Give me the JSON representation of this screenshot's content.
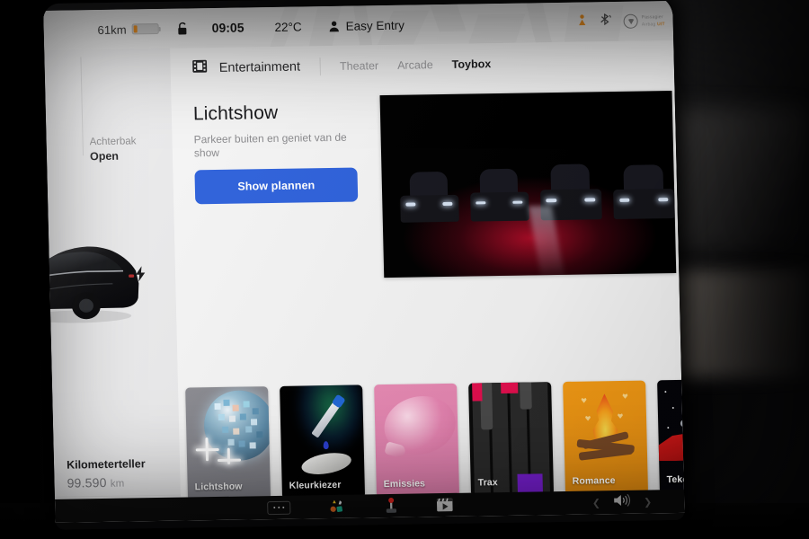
{
  "statusbar": {
    "range": "61km",
    "battery_fill_color": "#e8830c",
    "lock_icon": "lock-icon",
    "clock": "09:05",
    "temperature": "22°C",
    "driver_profile_icon": "person-icon",
    "driver_profile": "Easy Entry",
    "right_icons": [
      {
        "name": "seat-heater-icon",
        "color": "#e0891f"
      },
      {
        "name": "bluetooth-icon",
        "color": "#4c4c4c"
      }
    ],
    "account_chip": {
      "logo_icon": "tesla-logo-icon",
      "line1": "Passagier",
      "line2": "Airbag",
      "line2_status": "UIT"
    }
  },
  "sidebar": {
    "trunk": {
      "label": "Achterbak",
      "state": "Open"
    },
    "car_image": "tesla-model-3-rear-render",
    "charge_port_icon": "lightning-bolt-icon",
    "odometer": {
      "label": "Kilometerteller",
      "value": "99.590",
      "unit": "km"
    }
  },
  "app": {
    "icon": "entertainment-film-icon",
    "name": "Entertainment",
    "tabs": [
      {
        "label": "Theater",
        "active": false
      },
      {
        "label": "Arcade",
        "active": false
      },
      {
        "label": "Toybox",
        "active": true
      }
    ]
  },
  "hero": {
    "title": "Lichtshow",
    "subtitle": "Parkeer buiten en geniet van de show",
    "cta_label": "Show plannen",
    "cta_color": "#2f62db",
    "preview": "four-tesla-cars-red-light-show-video"
  },
  "tiles": [
    {
      "label": "Lichtshow",
      "art": "disco-ball",
      "bg": "#83838a"
    },
    {
      "label": "Kleurkiezer",
      "art": "eyedropper",
      "bg": "#000000"
    },
    {
      "label": "Emissies",
      "art": "whoopee-cushion",
      "bg": "#e384b2"
    },
    {
      "label": "Trax",
      "art": "piano-keys",
      "bg": "#0b0b0b"
    },
    {
      "label": "Romance",
      "art": "campfire",
      "bg": "#f2960f"
    },
    {
      "label": "Tekenblok",
      "art": "roadster-in-space",
      "bg": "#05050a"
    }
  ],
  "bottombar": {
    "buttons": [
      {
        "name": "more-menu",
        "icon": "ellipsis-icon"
      },
      {
        "name": "toybox",
        "icon": "toybox-shapes-icon"
      },
      {
        "name": "arcade",
        "icon": "joystick-icon"
      },
      {
        "name": "theater",
        "icon": "film-clapper-icon"
      }
    ],
    "volume_icon": "speaker-volume-icon",
    "prev_icon": "chevron-left-icon",
    "next_icon": "chevron-right-icon"
  }
}
